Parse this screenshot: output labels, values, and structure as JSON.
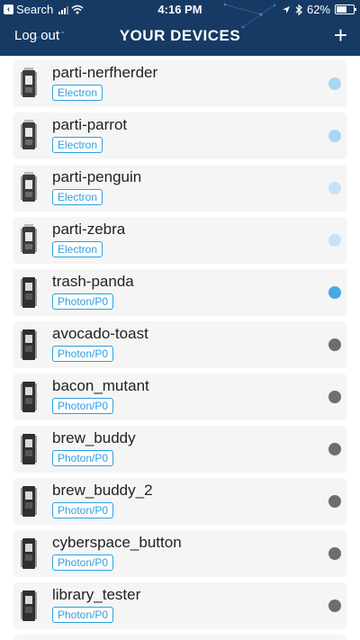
{
  "status_bar": {
    "back_label": "Search",
    "time": "4:16 PM",
    "battery": "62%"
  },
  "nav": {
    "title": "YOUR DEVICES",
    "logout_label": "Log out",
    "add_label": "+"
  },
  "colors": {
    "header_bg": "#163a64",
    "badge": "#2e9fe0",
    "online": "#2e9fe0",
    "online_light": "#a9d6f5",
    "offline": "#6e6e6e"
  },
  "devices": [
    {
      "name": "parti-nerfherder",
      "platform": "Electron",
      "icon": "electron-board-icon",
      "status": "online-light",
      "dot_color": "#a9d6f5"
    },
    {
      "name": "parti-parrot",
      "platform": "Electron",
      "icon": "electron-board-icon",
      "status": "online-light",
      "dot_color": "#a9d6f5"
    },
    {
      "name": "parti-penguin",
      "platform": "Electron",
      "icon": "electron-board-icon",
      "status": "online-light",
      "dot_color": "#c5e3f8"
    },
    {
      "name": "parti-zebra",
      "platform": "Electron",
      "icon": "electron-board-icon",
      "status": "online-light",
      "dot_color": "#c5e3f8"
    },
    {
      "name": "trash-panda",
      "platform": "Photon/P0",
      "icon": "photon-board-icon",
      "status": "online",
      "dot_color": "#4aa7e6"
    },
    {
      "name": "avocado-toast",
      "platform": "Photon/P0",
      "icon": "photon-board-icon",
      "status": "offline",
      "dot_color": "#6e6e6e"
    },
    {
      "name": "bacon_mutant",
      "platform": "Photon/P0",
      "icon": "photon-board-icon",
      "status": "offline",
      "dot_color": "#6e6e6e"
    },
    {
      "name": "brew_buddy",
      "platform": "Photon/P0",
      "icon": "photon-board-icon",
      "status": "offline",
      "dot_color": "#6e6e6e"
    },
    {
      "name": "brew_buddy_2",
      "platform": "Photon/P0",
      "icon": "photon-board-icon",
      "status": "offline",
      "dot_color": "#6e6e6e"
    },
    {
      "name": "cyberspace_button",
      "platform": "Photon/P0",
      "icon": "photon-board-icon",
      "status": "offline",
      "dot_color": "#6e6e6e"
    },
    {
      "name": "library_tester",
      "platform": "Photon/P0",
      "icon": "photon-board-icon",
      "status": "offline",
      "dot_color": "#6e6e6e"
    }
  ]
}
